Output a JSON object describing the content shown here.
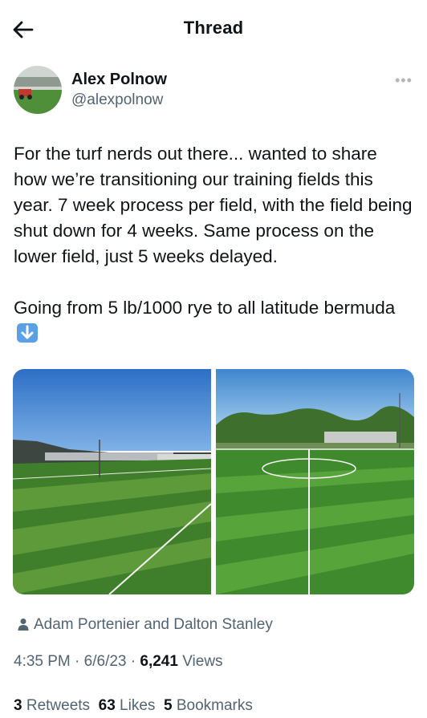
{
  "header": {
    "title": "Thread"
  },
  "author": {
    "name": "Alex Polnow",
    "handle": "@alexpolnow"
  },
  "tweet": {
    "paragraph1": "For the turf nerds out there... wanted to share how we’re transitioning our training fields this year. 7 week process per field, with the field being shut down for 4 weeks. Same process on the lower field, just 5 weeks delayed.",
    "paragraph2": "Going from 5 lb/1000 rye to all latitude bermuda"
  },
  "tagged": "Adam Portenier and Dalton Stanley",
  "meta": {
    "time": "4:35 PM",
    "sep": "·",
    "date": "6/6/23",
    "views_count": "6,241",
    "views_label": "Views"
  },
  "stats": {
    "retweets_count": "3",
    "retweets_label": "Retweets",
    "likes_count": "63",
    "likes_label": "Likes",
    "bookmarks_count": "5",
    "bookmarks_label": "Bookmarks"
  },
  "icons": {
    "back": "arrow-left-icon",
    "more": "more-horizontal-icon",
    "person": "person-icon",
    "emoji": "down-arrow-emoji"
  },
  "colors": {
    "text": "#0f1419",
    "secondary": "#536471",
    "emoji_blue": "#5aa0e6"
  }
}
